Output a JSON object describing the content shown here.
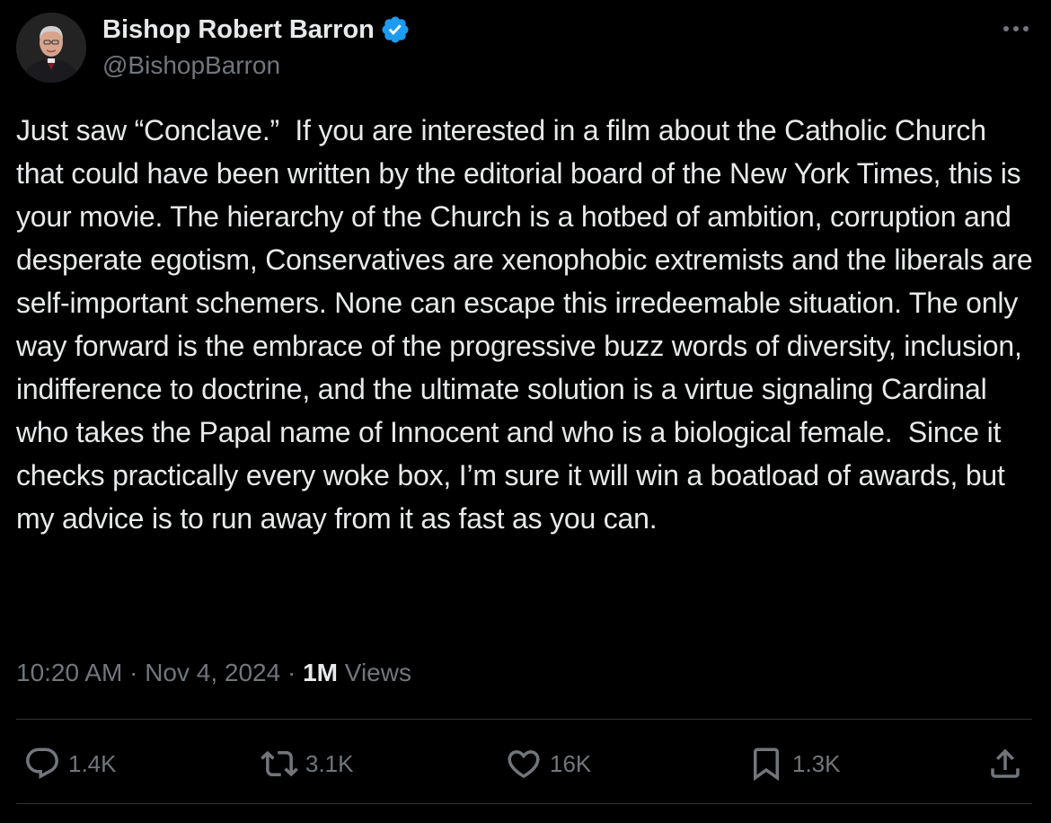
{
  "author": {
    "name": "Bishop Robert Barron",
    "handle": "@BishopBarron",
    "verified": true
  },
  "tweet": {
    "text": "Just saw “Conclave.”  If you are interested in a film about the Catholic Church that could have been written by the editorial board of the New York Times, this is your movie. The hierarchy of the Church is a hotbed of ambition, corruption and desperate egotism, Conservatives are xenophobic extremists and the liberals are self-important schemers. None can escape this irredeemable situation. The only way forward is the embrace of the progressive buzz words of diversity, inclusion, indifference to doctrine, and the ultimate solution is a virtue signaling Cardinal who takes the Papal name of Innocent and who is a biological female.  Since it checks practically every woke box, I’m sure it will win a boatload of awards, but my advice is to run away from it as fast as you can.",
    "time": "10:20 AM",
    "date": "Nov 4, 2024",
    "separator": "·",
    "views_count": "1M",
    "views_label": "Views"
  },
  "actions": {
    "reply": {
      "icon": "reply-icon",
      "count": "1.4K"
    },
    "retweet": {
      "icon": "retweet-icon",
      "count": "3.1K"
    },
    "like": {
      "icon": "heart-icon",
      "count": "16K"
    },
    "bookmark": {
      "icon": "bookmark-icon",
      "count": "1.3K"
    },
    "share": {
      "icon": "share-icon"
    }
  },
  "colors": {
    "background": "#000000",
    "text_primary": "#e7e9ea",
    "text_secondary": "#71767b",
    "verified_blue": "#1d9bf0",
    "divider": "#2f3336"
  }
}
